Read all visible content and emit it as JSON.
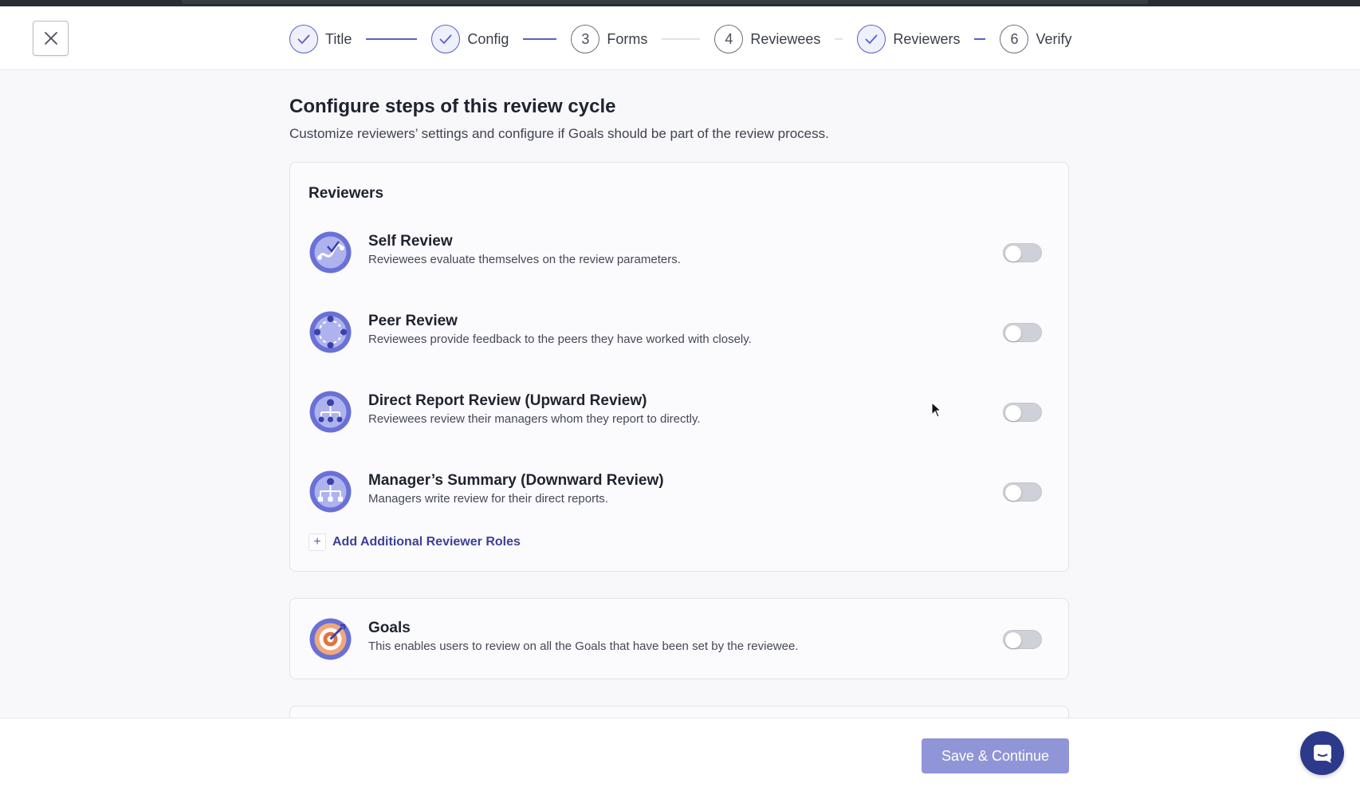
{
  "colors": {
    "accent": "#5a5fc7",
    "primary_button": "#8f95d6",
    "link": "#3d3f9a",
    "chat": "#2d3a8c",
    "toggle_off": "#cfd1d8"
  },
  "header": {
    "close_icon": "close-icon",
    "steps": [
      {
        "marker": "",
        "label": "Title",
        "state": "done"
      },
      {
        "marker": "",
        "label": "Config",
        "state": "done"
      },
      {
        "marker": "3",
        "label": "Forms",
        "state": "pending"
      },
      {
        "marker": "4",
        "label": "Reviewees",
        "state": "pending"
      },
      {
        "marker": "",
        "label": "Reviewers",
        "state": "done"
      },
      {
        "marker": "6",
        "label": "Verify",
        "state": "pending"
      }
    ]
  },
  "main": {
    "title": "Configure steps of this review cycle",
    "subtitle": "Customize reviewers’ settings and configure if Goals should be part of the review process."
  },
  "reviewers": {
    "title": "Reviewers",
    "items": [
      {
        "title": "Self Review",
        "description": "Reviewees evaluate themselves on the review parameters.",
        "icon": "self-review-icon",
        "enabled": false
      },
      {
        "title": "Peer Review",
        "description": "Reviewees provide feedback to the peers they have worked with closely.",
        "icon": "peer-review-icon",
        "enabled": false
      },
      {
        "title": "Direct Report Review (Upward Review)",
        "description": "Reviewees review their managers whom they report to directly.",
        "icon": "upward-review-icon",
        "enabled": false
      },
      {
        "title": "Manager’s Summary (Downward Review)",
        "description": "Managers write review for their direct reports.",
        "icon": "downward-review-icon",
        "enabled": false
      }
    ],
    "add_label": "Add Additional Reviewer Roles",
    "add_icon": "plus-icon"
  },
  "goals": {
    "title": "Goals",
    "description": "This enables users to review on all the Goals that have been set by the reviewee.",
    "icon": "goals-target-icon",
    "enabled": false
  },
  "footer": {
    "save_label": "Save & Continue",
    "chat_icon": "chat-icon"
  }
}
